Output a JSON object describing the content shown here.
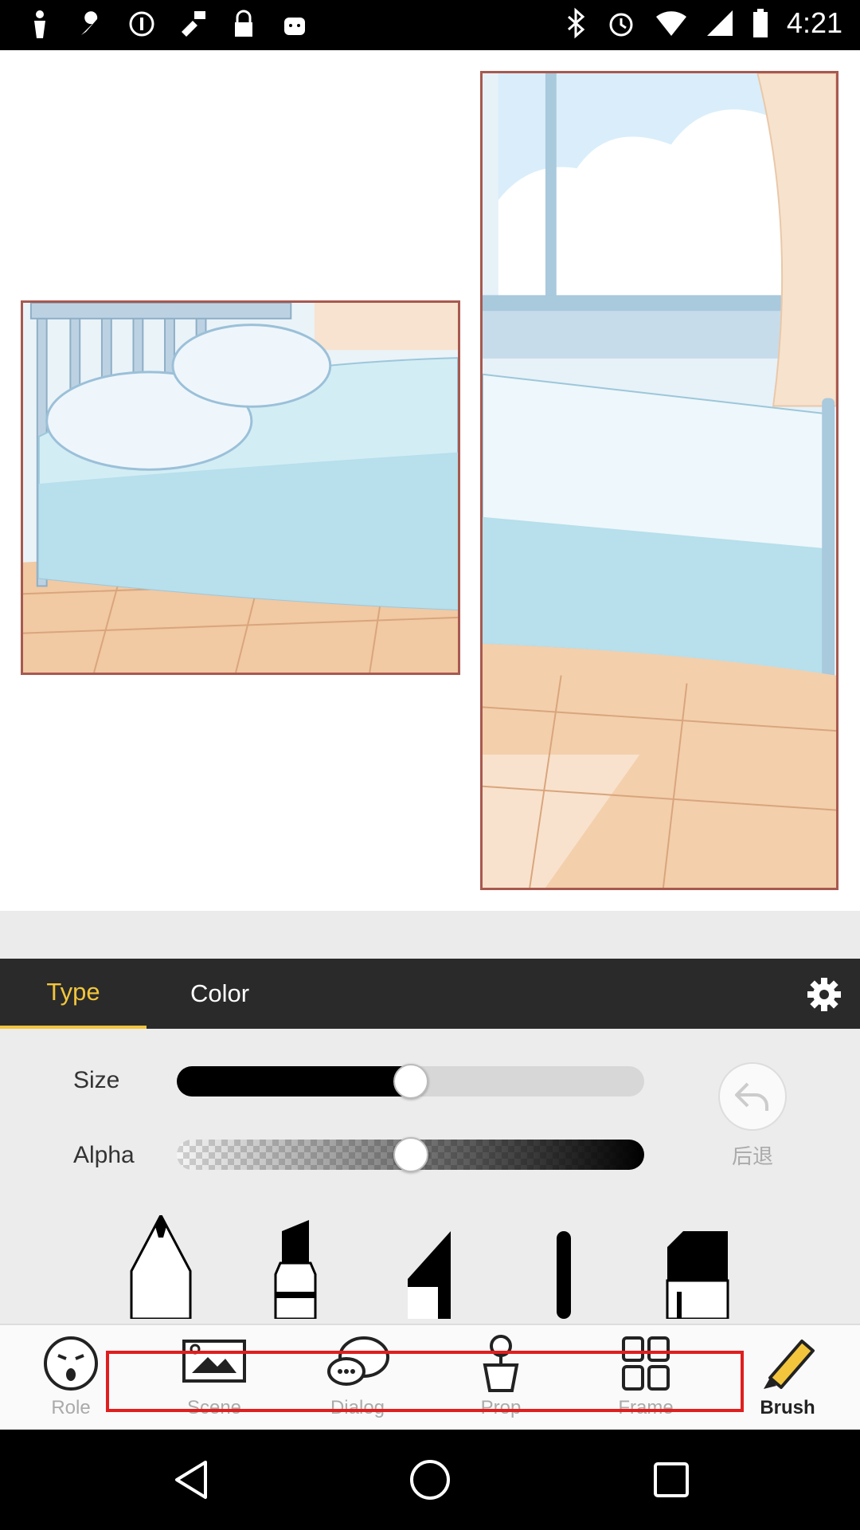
{
  "status_bar": {
    "time": "4:21",
    "left_icons": [
      "person-icon",
      "wrench-icon",
      "info-icon",
      "fake-gps-icon",
      "lock-icon",
      "android-icon"
    ],
    "right_icons": [
      "bluetooth-icon",
      "alarm-icon",
      "wifi-icon",
      "signal-icon",
      "battery-icon"
    ]
  },
  "canvas": {
    "panels": [
      {
        "name": "bedroom-bed-panel",
        "scene": "bed-with-pillows"
      },
      {
        "name": "bedroom-window-panel",
        "scene": "window-and-bed"
      }
    ]
  },
  "brush_panel": {
    "tabs": [
      {
        "label": "Type",
        "active": true
      },
      {
        "label": "Color",
        "active": false
      }
    ],
    "size_label": "Size",
    "size_value": 0.5,
    "alpha_label": "Alpha",
    "alpha_value": 0.5,
    "undo_label": "后退",
    "brush_types": [
      "pencil",
      "marker",
      "chisel",
      "round-brush",
      "eraser"
    ]
  },
  "bottom_nav": {
    "items": [
      {
        "label": "Role",
        "icon": "surprised-face-icon",
        "active": false
      },
      {
        "label": "Scene",
        "icon": "picture-icon",
        "active": false
      },
      {
        "label": "Dialog",
        "icon": "speech-bubble-icon",
        "active": false
      },
      {
        "label": "Prop",
        "icon": "plant-pot-icon",
        "active": false
      },
      {
        "label": "Frame",
        "icon": "grid-icon",
        "active": false
      },
      {
        "label": "Brush",
        "icon": "highlighter-icon",
        "active": true
      }
    ]
  },
  "colors": {
    "accent": "#f2c53d",
    "tab_bar": "#2a2a2a",
    "panel_border": "#a8594f",
    "highlight": "#e01e1e"
  }
}
